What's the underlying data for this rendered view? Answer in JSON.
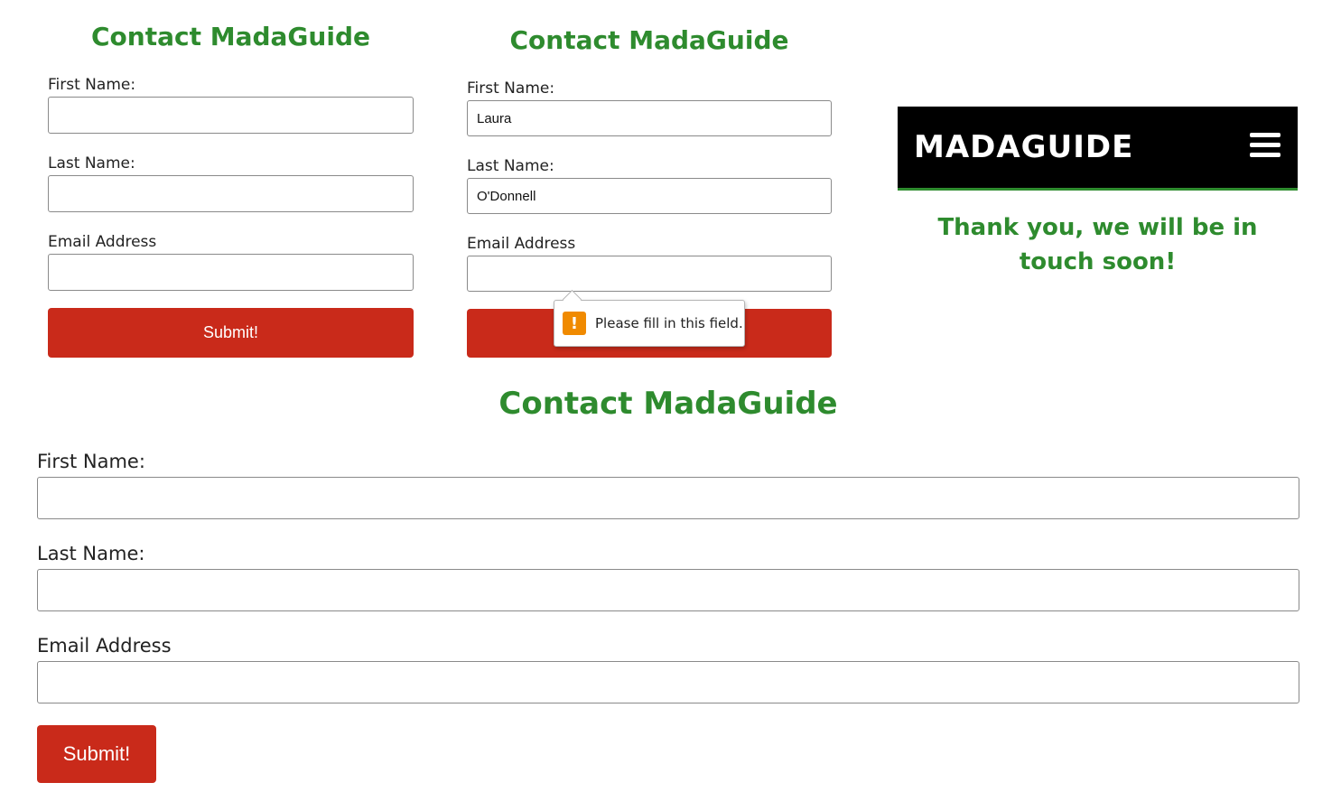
{
  "panel_small_empty": {
    "title": "Contact MadaGuide",
    "first_name_label": "First Name:",
    "last_name_label": "Last Name:",
    "email_label": "Email Address",
    "first_name_value": "",
    "last_name_value": "",
    "email_value": "",
    "submit_label": "Submit!"
  },
  "panel_small_filled": {
    "title": "Contact MadaGuide",
    "first_name_label": "First Name:",
    "last_name_label": "Last Name:",
    "email_label": "Email Address",
    "first_name_value": "Laura",
    "last_name_value": "O'Donnell",
    "email_value": "",
    "submit_label": "",
    "validation_tooltip": {
      "icon": "warning-icon",
      "icon_glyph": "!",
      "message": "Please fill in this field."
    }
  },
  "mobile_panel": {
    "brand": "MADAGUIDE",
    "menu_icon": "hamburger-menu-icon",
    "thank_you_message": "Thank you, we will be in touch soon!"
  },
  "panel_wide": {
    "title": "Contact MadaGuide",
    "first_name_label": "First Name:",
    "last_name_label": "Last Name:",
    "email_label": "Email Address",
    "first_name_value": "",
    "last_name_value": "",
    "email_value": "",
    "submit_label": "Submit!"
  },
  "colors": {
    "heading_green": "#2e8b2e",
    "button_red": "#c92a1a",
    "navbar_black": "#000000",
    "warning_orange": "#f08a00"
  }
}
